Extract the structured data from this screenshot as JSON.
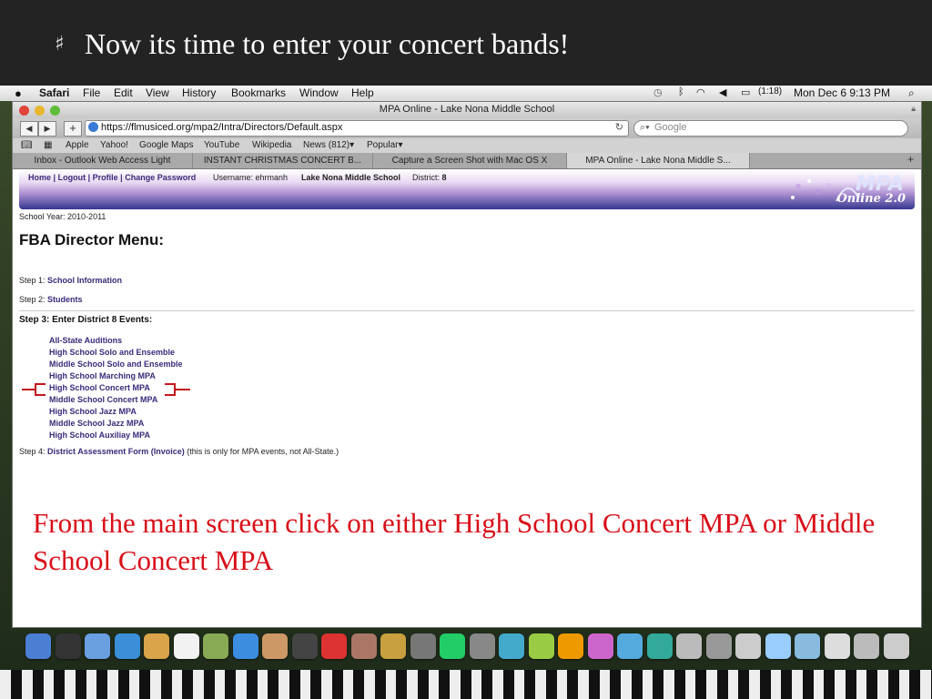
{
  "slide": {
    "bullet_symbol": "♯",
    "title": "Now its time to enter your concert bands!"
  },
  "menubar": {
    "apple_icon": "apple-logo-icon",
    "items": [
      "Safari",
      "File",
      "Edit",
      "View",
      "History",
      "Bookmarks",
      "Window",
      "Help"
    ],
    "status": {
      "battery": "(1:18)",
      "datetime": "Mon Dec 6  9:13 PM"
    }
  },
  "browser": {
    "window_title": "MPA Online - Lake Nona Middle School",
    "url": "https://flmusiced.org/mpa2/Intra/Directors/Default.aspx",
    "search_placeholder": "Google",
    "bookmarks": [
      "Apple",
      "Yahoo!",
      "Google Maps",
      "YouTube",
      "Wikipedia",
      "News (812)▾",
      "Popular▾"
    ],
    "tabs": [
      "Inbox - Outlook Web Access Light",
      "INSTANT CHRISTMAS CONCERT B...",
      "Capture a Screen Shot with Mac OS X",
      "MPA Online - Lake Nona Middle S..."
    ]
  },
  "page": {
    "nav": {
      "home": "Home",
      "logout": "Logout",
      "profile": "Profile",
      "change_password": "Change Password",
      "sep": "|"
    },
    "username_label": "Username:",
    "username": "ehrmanh",
    "school": "Lake Nona Middle School",
    "district_label": "District:",
    "district": "8",
    "logo_text": "MPA",
    "logo_sub": "Online 2.0",
    "school_year": "School Year: 2010-2011",
    "heading": "FBA Director Menu:",
    "step1_label": "Step 1:",
    "step1_link": "School Information",
    "step2_label": "Step 2:",
    "step2_link": "Students",
    "step3": "Step 3: Enter District 8 Events:",
    "events": [
      "All-State Auditions",
      "High School Solo and Ensemble",
      "Middle School Solo and Ensemble",
      "High School Marching MPA",
      "High School Concert MPA",
      "Middle School Concert MPA",
      "High School Jazz MPA",
      "Middle School Jazz MPA",
      "High School Auxiliay MPA"
    ],
    "step4_label": "Step 4:",
    "step4_link": "District Assessment Form (Invoice)",
    "step4_note": "(this is only for MPA events, not All-State.)"
  },
  "instruction": "From the main screen click on either High School Concert MPA or Middle School Concert MPA",
  "colors": {
    "instruction": "#d80e18",
    "link": "#3b2a7a",
    "banner_dark": "#34388f"
  }
}
